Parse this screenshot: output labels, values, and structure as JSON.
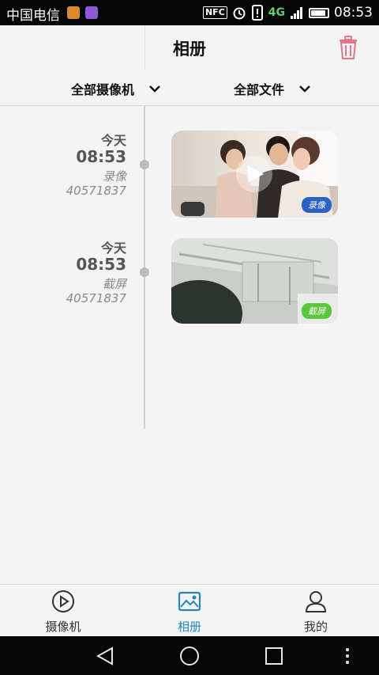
{
  "status_bar": {
    "carrier": "中国电信",
    "time": "08:53",
    "network": "4G",
    "nfc": "NFC"
  },
  "header": {
    "title": "相册"
  },
  "filters": {
    "camera": "全部摄像机",
    "file": "全部文件"
  },
  "entries": [
    {
      "day": "今天",
      "time": "08:53",
      "type": "录像",
      "device_id": "40571837",
      "badge": "录像",
      "badge_color": "#2a62c9"
    },
    {
      "day": "今天",
      "time": "08:53",
      "type": "截屏",
      "device_id": "40571837",
      "badge": "截屏",
      "badge_color": "#5cc73a"
    }
  ],
  "bottom_nav": {
    "items": [
      {
        "label": "摄像机",
        "icon": "play-circle-icon"
      },
      {
        "label": "相册",
        "icon": "photo-album-icon",
        "active": true
      },
      {
        "label": "我的",
        "icon": "person-icon"
      }
    ]
  },
  "colors": {
    "accent": "#1f86c9",
    "trash": "#e3758a"
  }
}
